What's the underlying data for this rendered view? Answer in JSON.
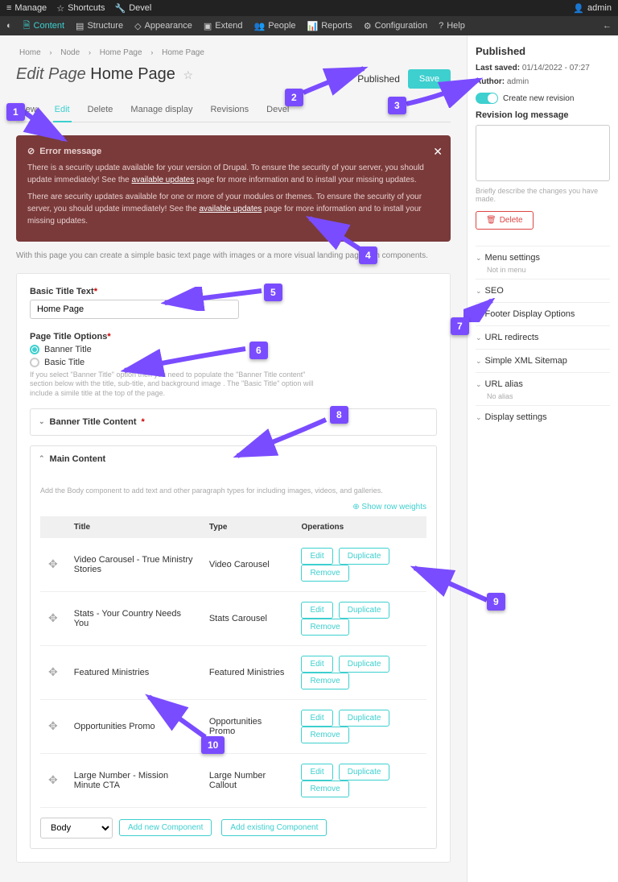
{
  "topbar": {
    "manage": "Manage",
    "shortcuts": "Shortcuts",
    "devel": "Devel",
    "user": "admin"
  },
  "adminbar": {
    "items": [
      {
        "label": "Content"
      },
      {
        "label": "Structure"
      },
      {
        "label": "Appearance"
      },
      {
        "label": "Extend"
      },
      {
        "label": "People"
      },
      {
        "label": "Reports"
      },
      {
        "label": "Configuration"
      },
      {
        "label": "Help"
      }
    ]
  },
  "breadcrumbs": [
    "Home",
    "Node",
    "Home Page",
    "Home Page"
  ],
  "page": {
    "prefix": "Edit Page",
    "title": "Home Page",
    "published_label": "Published",
    "save": "Save"
  },
  "tabs": [
    "View",
    "Edit",
    "Delete",
    "Manage display",
    "Revisions",
    "Devel"
  ],
  "tabs_active": 1,
  "alert": {
    "title": "Error message",
    "line1a": "There is a security update available for your version of Drupal. To ensure the security of your server, you should update immediately! See the ",
    "link1": "available updates",
    "line1b": " page for more information and to install your missing updates.",
    "line2a": "There are security updates available for one or more of your modules or themes. To ensure the security of your server, you should update immediately! See the ",
    "link2": "available updates",
    "line2b": " page for more information and to install your missing updates."
  },
  "helper": "With this page you can create a simple basic text page with images or a more visual landing page with components.",
  "basic_title": {
    "label": "Basic Title Text",
    "value": "Home Page"
  },
  "page_title_options": {
    "label": "Page Title Options",
    "banner": "Banner Title",
    "basic": "Basic Title",
    "hint": "If you select \"Banner Title\" option then you need to populate the \"Banner Title content\" section below with the title, sub-title, and background image . The \"Basic Title\" option will include a simile title at the top of the page."
  },
  "banner_content": {
    "label": "Banner Title Content"
  },
  "main_content": {
    "label": "Main Content",
    "sub": "Add the Body component to add text and other paragraph types for including images, videos, and galleries.",
    "show_weights": "Show row weights",
    "headers": {
      "title": "Title",
      "type": "Type",
      "ops": "Operations"
    },
    "ops": {
      "edit": "Edit",
      "dup": "Duplicate",
      "remove": "Remove"
    },
    "rows": [
      {
        "title": "Video Carousel - True Ministry Stories",
        "type": "Video Carousel"
      },
      {
        "title": "Stats - Your Country Needs You",
        "type": "Stats Carousel"
      },
      {
        "title": "Featured Ministries",
        "type": "Featured Ministries"
      },
      {
        "title": "Opportunities Promo",
        "type": "Opportunities Promo"
      },
      {
        "title": "Large Number - Mission Minute CTA",
        "type": "Large Number Callout"
      }
    ],
    "select": "Body",
    "add_new": "Add new Component",
    "add_existing": "Add existing Component"
  },
  "sidebar": {
    "status": "Published",
    "saved_label": "Last saved:",
    "saved_value": "01/14/2022 - 07:27",
    "author_label": "Author:",
    "author_value": "admin",
    "create_rev": "Create new revision",
    "rev_log": "Revision log message",
    "rev_hint": "Briefly describe the changes you have made.",
    "delete": "Delete",
    "acc": [
      {
        "label": "Menu settings",
        "sub": "Not in menu"
      },
      {
        "label": "SEO"
      },
      {
        "label": "Footer Display Options"
      },
      {
        "label": "URL redirects"
      },
      {
        "label": "Simple XML Sitemap"
      },
      {
        "label": "URL alias",
        "sub": "No alias"
      },
      {
        "label": "Display settings"
      }
    ]
  },
  "callouts": [
    "1",
    "2",
    "3",
    "4",
    "5",
    "6",
    "7",
    "8",
    "9",
    "10"
  ]
}
